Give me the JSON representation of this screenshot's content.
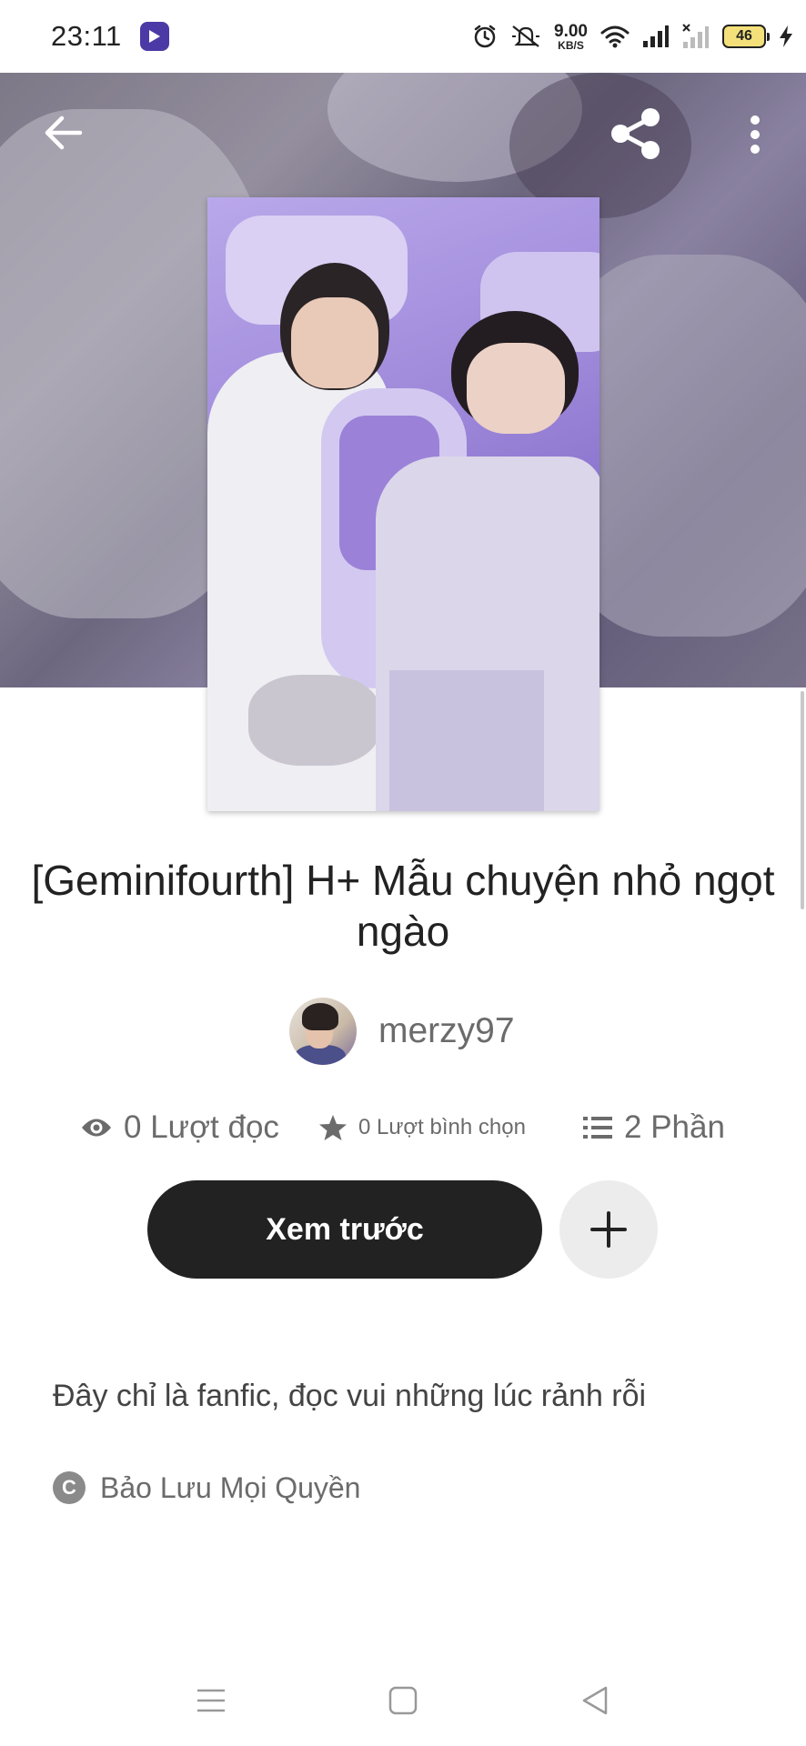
{
  "status_bar": {
    "time": "23:11",
    "net_speed_value": "9.00",
    "net_speed_unit": "KB/S",
    "battery": "46"
  },
  "header": {
    "back_icon": "arrow-left-icon",
    "share_icon": "share-icon",
    "more_icon": "more-vertical-icon"
  },
  "story": {
    "title": "[Geminifourth] H+     Mẫu chuyện nhỏ ngọt ngào",
    "author": "merzy97",
    "stats": {
      "reads": "0 Lượt đọc",
      "votes": "0 Lượt bình chọn",
      "parts": "2 Phần"
    },
    "preview_button": "Xem trước",
    "description": "Đây chỉ là fanfic, đọc vui những lúc rảnh rỗi",
    "copyright": "Bảo Lưu Mọi Quyền"
  },
  "colors": {
    "primary_button": "#222222",
    "secondary_text": "#6b6b6b",
    "cover_accent": "#9d87d9"
  }
}
